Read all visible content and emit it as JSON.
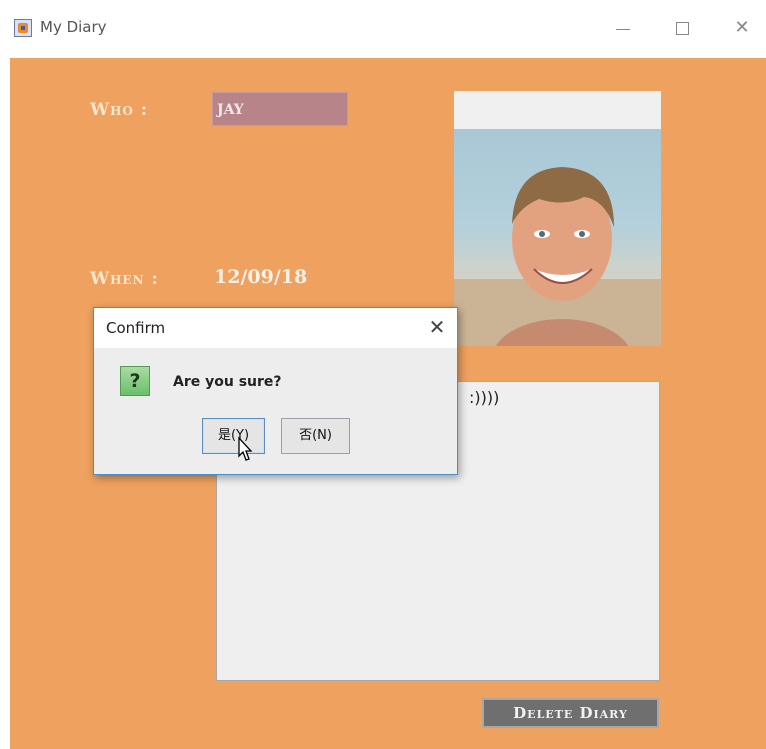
{
  "window": {
    "title": "My Diary",
    "controls": {
      "minimize": "—",
      "close": "✕"
    }
  },
  "form": {
    "who_label": "Who :",
    "who_value": "JAY",
    "when_label": "When :",
    "when_value": "12/09/18",
    "diary_text": ":))))",
    "delete_button": "Delete Diary"
  },
  "dialog": {
    "title": "Confirm",
    "close": "✕",
    "icon_glyph": "?",
    "message": "Are you sure?",
    "yes_button": "是(Y)",
    "no_button": "否(N)"
  },
  "colors": {
    "background": "#efa15f",
    "who_field": "#b7848a",
    "delete_button": "#6f6f6f",
    "dialog_border": "#4a8fc9"
  },
  "icons": [
    "java-app-icon",
    "question-icon",
    "mouse-cursor-icon",
    "close-icon"
  ]
}
